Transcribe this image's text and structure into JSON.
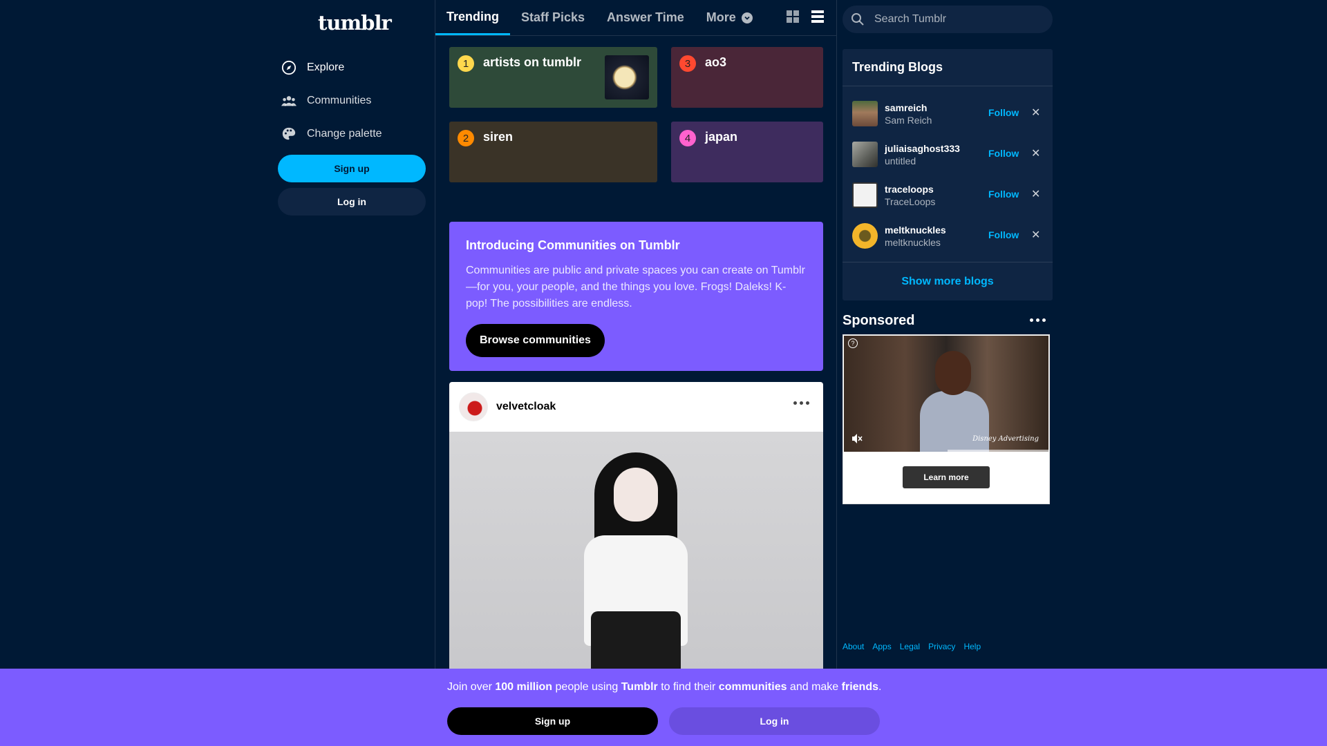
{
  "sidebar": {
    "logo": "tumblr",
    "items": [
      {
        "label": "Explore",
        "icon": "compass-icon"
      },
      {
        "label": "Communities",
        "icon": "people-icon"
      },
      {
        "label": "Change palette",
        "icon": "palette-icon"
      }
    ],
    "signup_label": "Sign up",
    "login_label": "Log in"
  },
  "tabs": [
    {
      "label": "Trending",
      "active": true
    },
    {
      "label": "Staff Picks"
    },
    {
      "label": "Answer Time"
    },
    {
      "label": "More"
    }
  ],
  "trending": [
    {
      "rank": "1",
      "title": "artists on tumblr",
      "badge_color": "#ffd84d",
      "bg": "#2e4a39"
    },
    {
      "rank": "3",
      "title": "ao3",
      "badge_color": "#ff4930",
      "bg": "#4a2638"
    },
    {
      "rank": "2",
      "title": "siren",
      "badge_color": "#ff8a00",
      "bg": "#3a3327"
    },
    {
      "rank": "4",
      "title": "japan",
      "badge_color": "#ff62ce",
      "bg": "#3e2c5e"
    }
  ],
  "promo": {
    "title": "Introducing Communities on Tumblr",
    "body": "Communities are public and private spaces you can create on Tumblr—for you, your people, and the things you love. Frogs! Daleks! K-pop! The possibilities are endless.",
    "button": "Browse communities"
  },
  "post": {
    "author": "velvetcloak"
  },
  "search": {
    "placeholder": "Search Tumblr"
  },
  "trending_blogs": {
    "title": "Trending Blogs",
    "follow_label": "Follow",
    "blogs": [
      {
        "name": "samreich",
        "title": "Sam Reich",
        "avatar_color": "#6b7a4e"
      },
      {
        "name": "juliaisaghost333",
        "title": "untitled",
        "avatar_color": "#8c8f88"
      },
      {
        "name": "traceloops",
        "title": "TraceLoops",
        "avatar_color": "#f2f2f2"
      },
      {
        "name": "meltknuckles",
        "title": "meltknuckles",
        "avatar_color": "#f3b52a"
      }
    ],
    "show_more": "Show more blogs"
  },
  "sponsored": {
    "title": "Sponsored",
    "brand": "Disney Advertising",
    "cta": "Learn more"
  },
  "footer_links": [
    "About",
    "Apps",
    "Legal",
    "Privacy",
    "Help"
  ],
  "banner": {
    "t1": "Join over ",
    "t2": "100 million",
    "t3": " people using ",
    "t4": "Tumblr",
    "t5": " to find their ",
    "t6": "communities",
    "t7": " and make ",
    "t8": "friends",
    "t9": ".",
    "signup_label": "Sign up",
    "login_label": "Log in"
  }
}
